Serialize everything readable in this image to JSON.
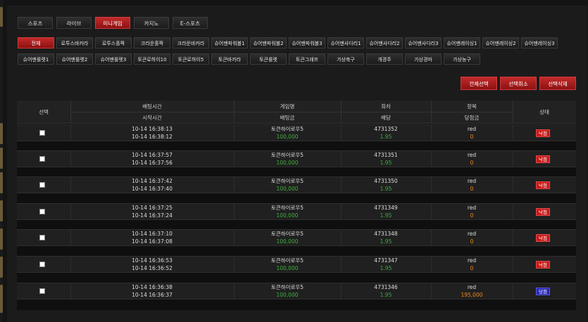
{
  "main_tabs": [
    {
      "label": "스포츠",
      "active": false
    },
    {
      "label": "라이브",
      "active": false
    },
    {
      "label": "미니게임",
      "active": true
    },
    {
      "label": "카지노",
      "active": false
    },
    {
      "label": "E-스포츠",
      "active": false
    }
  ],
  "sub_tabs": [
    {
      "label": "전체",
      "active": true
    },
    {
      "label": "로투스바카라",
      "active": false
    },
    {
      "label": "로투스홀짝",
      "active": false
    },
    {
      "label": "크라운홀짝",
      "active": false
    },
    {
      "label": "크라운바카라",
      "active": false
    },
    {
      "label": "슈어맨파워볼1",
      "active": false
    },
    {
      "label": "슈어맨파워볼2",
      "active": false
    },
    {
      "label": "슈어맨파워볼3",
      "active": false
    },
    {
      "label": "슈어맨사다리1",
      "active": false
    },
    {
      "label": "슈어맨사다리2",
      "active": false
    },
    {
      "label": "슈어맨사다리3",
      "active": false
    },
    {
      "label": "슈어맨레이싱1",
      "active": false
    },
    {
      "label": "슈어맨레이싱2",
      "active": false
    },
    {
      "label": "슈어맨레이싱3",
      "active": false
    },
    {
      "label": "슈어맨룰렛1",
      "active": false
    },
    {
      "label": "슈어맨룰렛2",
      "active": false
    },
    {
      "label": "슈어맨룰렛3",
      "active": false
    },
    {
      "label": "토큰로하이10",
      "active": false
    },
    {
      "label": "토큰로하이5",
      "active": false
    },
    {
      "label": "토큰바카라",
      "active": false
    },
    {
      "label": "토큰룰렛",
      "active": false
    },
    {
      "label": "토큰그래프",
      "active": false
    },
    {
      "label": "가상축구",
      "active": false
    },
    {
      "label": "개경주",
      "active": false
    },
    {
      "label": "가상경마",
      "active": false
    },
    {
      "label": "가상농구",
      "active": false
    }
  ],
  "actions": {
    "select_all": "전체선택",
    "cancel_selected": "선택취소",
    "delete_selected": "선택삭제"
  },
  "table_header": {
    "select": "선택",
    "bet_time": "배팅시간",
    "start_time": "시작시간",
    "game_name": "게임명",
    "bet_amount": "배팅금",
    "round": "회차",
    "odds": "배당",
    "item": "항목",
    "win_amount": "당첨금",
    "status": "상태"
  },
  "rows": [
    {
      "bet_time": "10-14 16:38:13",
      "start_time": "10-14 16:38:12",
      "game": "토큰하이로우5",
      "amount": "100,000",
      "round": "4731352",
      "odds": "1.95",
      "pick": "red",
      "win": "0",
      "status": "낙첨",
      "won": false
    },
    {
      "bet_time": "10-14 16:37:57",
      "start_time": "10-14 16:37:56",
      "game": "토큰하이로우5",
      "amount": "100,000",
      "round": "4731351",
      "odds": "1.95",
      "pick": "red",
      "win": "0",
      "status": "낙첨",
      "won": false
    },
    {
      "bet_time": "10-14 16:37:42",
      "start_time": "10-14 16:37:40",
      "game": "토큰하이로우5",
      "amount": "100,000",
      "round": "4731350",
      "odds": "1.95",
      "pick": "red",
      "win": "0",
      "status": "낙첨",
      "won": false
    },
    {
      "bet_time": "10-14 16:37:25",
      "start_time": "10-14 16:37:24",
      "game": "토큰하이로우5",
      "amount": "100,000",
      "round": "4731349",
      "odds": "1.95",
      "pick": "red",
      "win": "0",
      "status": "낙첨",
      "won": false
    },
    {
      "bet_time": "10-14 16:37:10",
      "start_time": "10-14 16:37:08",
      "game": "토큰하이로우5",
      "amount": "100,000",
      "round": "4731348",
      "odds": "1.95",
      "pick": "red",
      "win": "0",
      "status": "낙첨",
      "won": false
    },
    {
      "bet_time": "10-14 16:36:53",
      "start_time": "10-14 16:36:52",
      "game": "토큰하이로우5",
      "amount": "100,000",
      "round": "4731347",
      "odds": "1.95",
      "pick": "red",
      "win": "0",
      "status": "낙첨",
      "won": false
    },
    {
      "bet_time": "10-14 16:36:38",
      "start_time": "10-14 16:36:37",
      "game": "토큰하이로우5",
      "amount": "100,000",
      "round": "4731346",
      "odds": "1.95",
      "pick": "red",
      "win": "195,000",
      "status": "당첨",
      "won": true
    }
  ]
}
